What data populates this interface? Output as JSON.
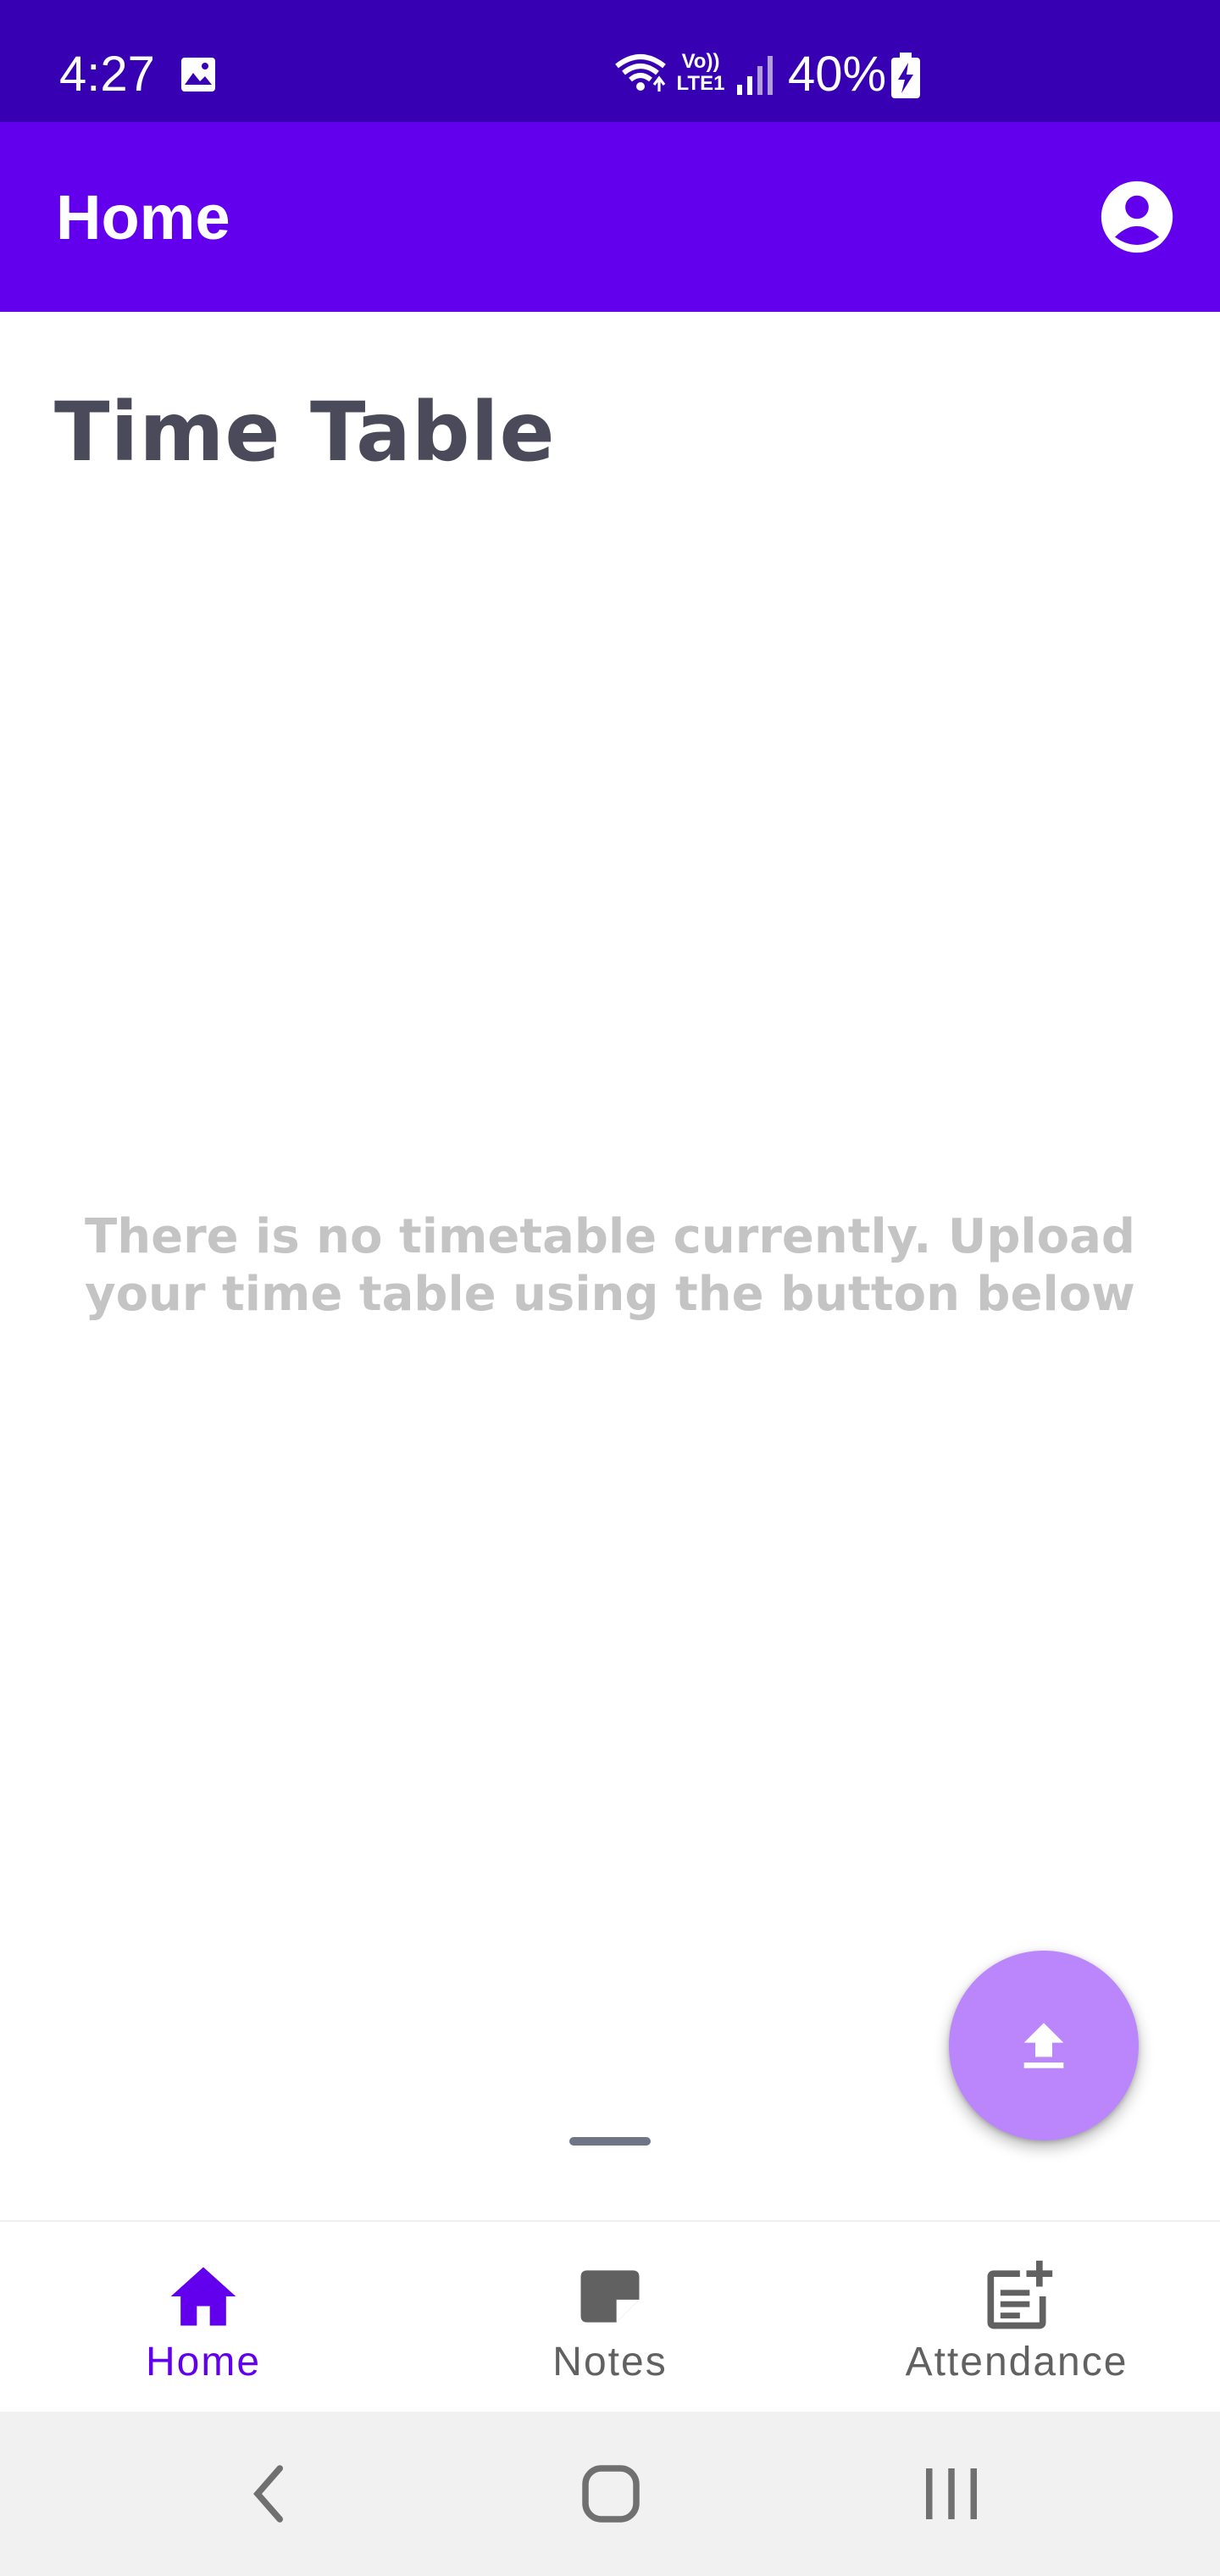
{
  "status_bar": {
    "time": "4:27",
    "volte_line1": "Vo))",
    "volte_line2": "LTE1",
    "battery": "40%",
    "icons": [
      "image-icon",
      "wifi-icon",
      "volte-icon",
      "signal-icon",
      "battery-charging-icon"
    ]
  },
  "app_bar": {
    "title": "Home",
    "account_icon": "account-circle-icon"
  },
  "content": {
    "section_title": "Time Table",
    "empty_message": "There is no timetable currently. Upload your time table using the button below"
  },
  "fab": {
    "icon": "upload-icon"
  },
  "bottom_nav": {
    "items": [
      {
        "label": "Home",
        "icon": "home-icon",
        "selected": true
      },
      {
        "label": "Notes",
        "icon": "note-icon",
        "selected": false
      },
      {
        "label": "Attendance",
        "icon": "post-add-icon",
        "selected": false
      }
    ]
  },
  "system_nav": {
    "buttons": [
      "back-icon",
      "home-circle-icon",
      "recents-icon"
    ]
  },
  "colors": {
    "status_bar": "#3700b3",
    "primary": "#6200ee",
    "fab": "#bb86fc",
    "title_text": "#4a4a5a",
    "empty_text": "#c4c4c4",
    "nav_selected": "#6200ee",
    "nav_unselected": "#616161",
    "system_nav_bg": "#f1f1f1"
  }
}
